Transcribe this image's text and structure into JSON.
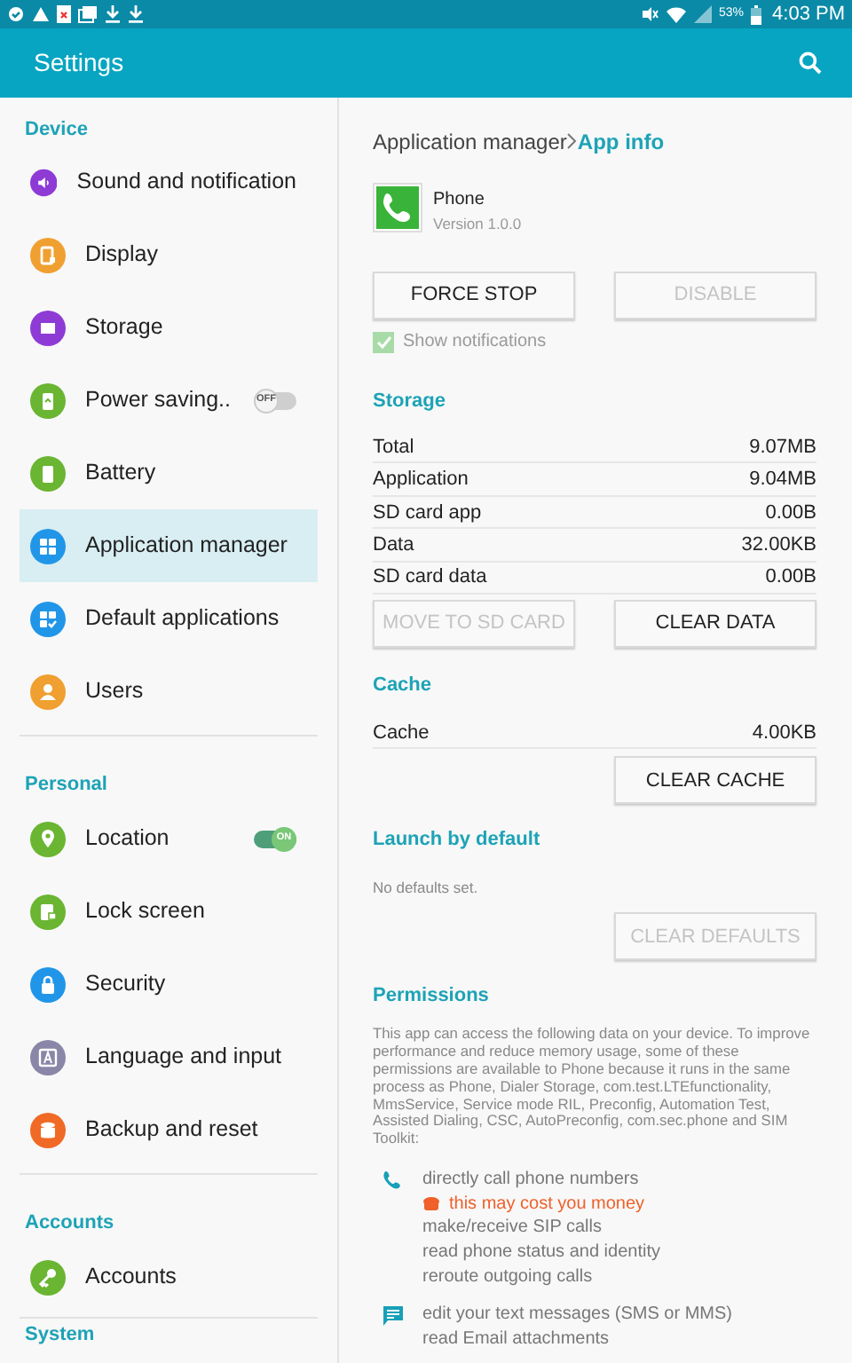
{
  "status_bar": {
    "battery": "53%",
    "time": "4:03 PM"
  },
  "app_bar": {
    "title": "Settings"
  },
  "sidebar": {
    "sections": [
      {
        "title": "Device",
        "items": [
          {
            "label": "Sound and notification",
            "color": "#8e3bd6",
            "selected": false
          },
          {
            "label": "Display",
            "color": "#f0a030",
            "selected": false
          },
          {
            "label": "Storage",
            "color": "#8e3bd6",
            "selected": false
          },
          {
            "label": "Power saving..",
            "color": "#6ab531",
            "selected": false,
            "toggle": {
              "on": false,
              "label": "OFF"
            }
          },
          {
            "label": "Battery",
            "color": "#6ab531",
            "selected": false
          },
          {
            "label": "Application manager",
            "color": "#2196e8",
            "selected": true
          },
          {
            "label": "Default applications",
            "color": "#2196e8",
            "selected": false
          },
          {
            "label": "Users",
            "color": "#f0a030",
            "selected": false
          }
        ]
      },
      {
        "title": "Personal",
        "items": [
          {
            "label": "Location",
            "color": "#6ab531",
            "selected": false,
            "toggle": {
              "on": true,
              "label": "ON"
            }
          },
          {
            "label": "Lock screen",
            "color": "#6ab531",
            "selected": false
          },
          {
            "label": "Security",
            "color": "#2196e8",
            "selected": false
          },
          {
            "label": "Language and input",
            "color": "#8a86a8",
            "selected": false
          },
          {
            "label": "Backup and reset",
            "color": "#f06a25",
            "selected": false
          }
        ]
      },
      {
        "title": "Accounts",
        "items": [
          {
            "label": "Accounts",
            "color": "#6ab531",
            "selected": false
          }
        ]
      },
      {
        "title": "System"
      }
    ]
  },
  "breadcrumb": {
    "parent": "Application manager",
    "current": "App info"
  },
  "app": {
    "name": "Phone",
    "version": "Version 1.0.0"
  },
  "actions": [
    {
      "label": "FORCE STOP",
      "disabled": false
    },
    {
      "label": "DISABLE",
      "disabled": true
    }
  ],
  "show_notifications": {
    "label": "Show notifications",
    "checked": true,
    "disabled": true
  },
  "storage": {
    "title": "Storage",
    "rows": [
      {
        "label": "Total",
        "value": "9.07MB"
      },
      {
        "label": "Application",
        "value": "9.04MB"
      },
      {
        "label": "SD card app",
        "value": "0.00B"
      },
      {
        "label": "Data",
        "value": "32.00KB"
      },
      {
        "label": "SD card data",
        "value": "0.00B"
      }
    ],
    "buttons": [
      {
        "label": "MOVE TO SD CARD",
        "disabled": true
      },
      {
        "label": "CLEAR DATA",
        "disabled": false
      }
    ]
  },
  "cache": {
    "title": "Cache",
    "rows": [
      {
        "label": "Cache",
        "value": "4.00KB"
      }
    ],
    "buttons": [
      {
        "label": "CLEAR CACHE",
        "disabled": false
      }
    ]
  },
  "launch": {
    "title": "Launch by default",
    "note": "No defaults set.",
    "buttons": [
      {
        "label": "CLEAR DEFAULTS",
        "disabled": true
      }
    ]
  },
  "permissions": {
    "title": "Permissions",
    "description": "This app can access the following data on your device. To improve performance and reduce memory usage, some of these permissions are available to Phone because it runs in the same process as Phone, Dialer Storage, com.test.LTEfunctionality, MmsService, Service mode RIL, Preconfig, Automation Test, Assisted Dialing, CSC, AutoPreconfig, com.sec.phone and SIM Toolkit:",
    "groups": [
      {
        "kind": "phone",
        "lines": [
          {
            "text": "directly call phone numbers",
            "warning": false
          },
          {
            "text": "this may cost you money",
            "warning": true
          },
          {
            "text": "make/receive SIP calls",
            "warning": false
          },
          {
            "text": "read phone status and identity",
            "warning": false
          },
          {
            "text": "reroute outgoing calls",
            "warning": false
          }
        ]
      },
      {
        "kind": "message",
        "lines": [
          {
            "text": "edit your text messages (SMS or MMS)",
            "warning": false
          },
          {
            "text": "read Email attachments",
            "warning": false
          }
        ]
      }
    ]
  }
}
